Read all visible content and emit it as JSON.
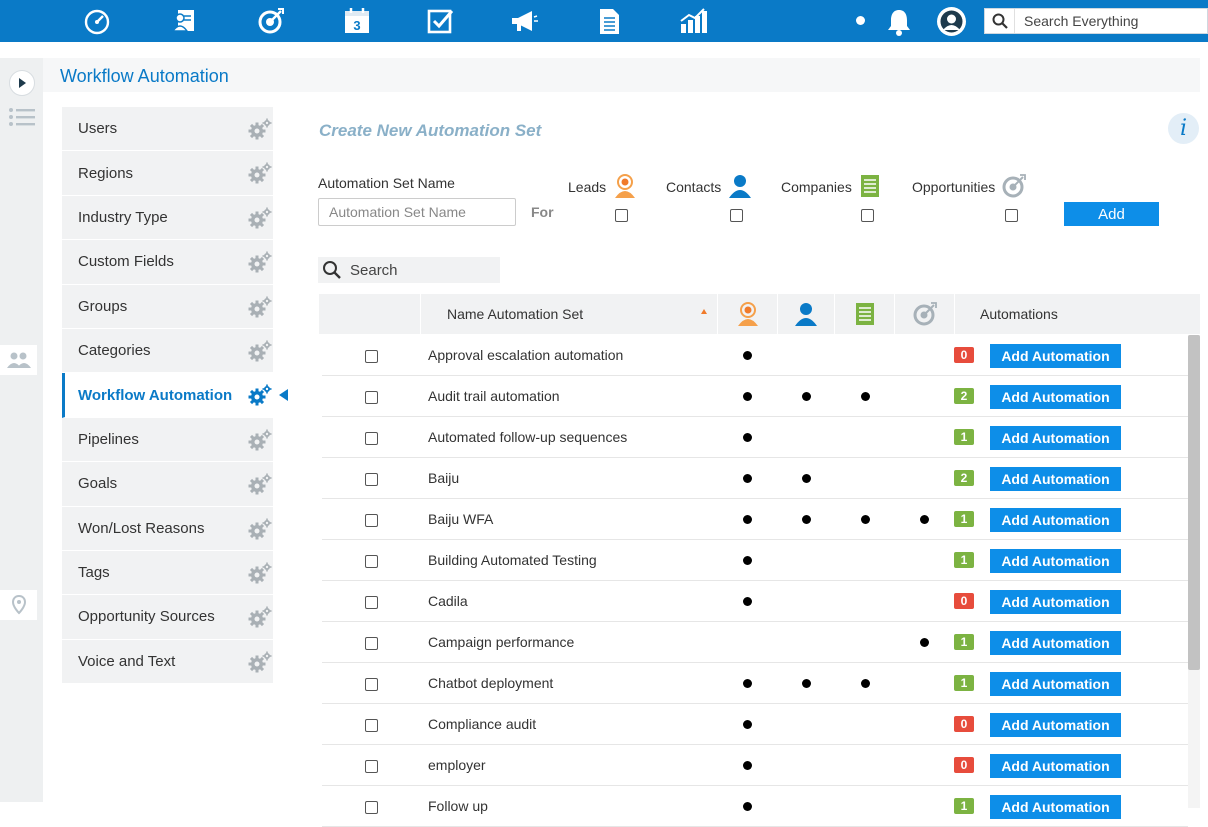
{
  "topbar": {
    "nav_icons": [
      "dashboard-icon",
      "contacts-card-icon",
      "opportunity-target-icon",
      "calendar-icon",
      "tasks-checkbox-icon",
      "campaign-megaphone-icon",
      "documents-icon",
      "reports-chart-icon"
    ],
    "calendar_day": "3",
    "search_placeholder": "Search Everything"
  },
  "page": {
    "title": "Workflow Automation"
  },
  "side_menu": {
    "items": [
      {
        "label": "Users"
      },
      {
        "label": "Regions"
      },
      {
        "label": "Industry Type"
      },
      {
        "label": "Custom Fields"
      },
      {
        "label": "Groups"
      },
      {
        "label": "Categories"
      },
      {
        "label": "Workflow Automation",
        "active": true
      },
      {
        "label": "Pipelines"
      },
      {
        "label": "Goals"
      },
      {
        "label": "Won/Lost Reasons"
      },
      {
        "label": "Tags"
      },
      {
        "label": "Opportunity Sources"
      },
      {
        "label": "Voice and Text"
      }
    ]
  },
  "create_form": {
    "title": "Create New Automation Set",
    "name_label": "Automation Set Name",
    "name_placeholder": "Automation Set Name",
    "for_label": "For",
    "types": [
      {
        "label": "Leads",
        "icon": "leads-icon"
      },
      {
        "label": "Contacts",
        "icon": "contacts-icon"
      },
      {
        "label": "Companies",
        "icon": "companies-icon"
      },
      {
        "label": "Opportunities",
        "icon": "opportunities-icon"
      }
    ],
    "add_label": "Add",
    "info_symbol": "i"
  },
  "table": {
    "search_placeholder": "Search",
    "headers": {
      "name": "Name Automation Set",
      "automations": "Automations"
    },
    "add_automation_label": "Add Automation",
    "colors": {
      "badge_zero": "#e74c3c",
      "badge_nonzero": "#7cb342",
      "accent": "#0a7ac7"
    },
    "rows": [
      {
        "name": "Approval escalation automation",
        "leads": true,
        "contacts": false,
        "companies": false,
        "opportunities": false,
        "count": "0"
      },
      {
        "name": "Audit trail automation",
        "leads": true,
        "contacts": true,
        "companies": true,
        "opportunities": false,
        "count": "2"
      },
      {
        "name": "Automated follow-up sequences",
        "leads": true,
        "contacts": false,
        "companies": false,
        "opportunities": false,
        "count": "1"
      },
      {
        "name": "Baiju",
        "leads": true,
        "contacts": true,
        "companies": false,
        "opportunities": false,
        "count": "2"
      },
      {
        "name": "Baiju WFA",
        "leads": true,
        "contacts": true,
        "companies": true,
        "opportunities": true,
        "count": "1"
      },
      {
        "name": "Building Automated Testing",
        "leads": true,
        "contacts": false,
        "companies": false,
        "opportunities": false,
        "count": "1"
      },
      {
        "name": "Cadila",
        "leads": true,
        "contacts": false,
        "companies": false,
        "opportunities": false,
        "count": "0"
      },
      {
        "name": "Campaign performance",
        "leads": false,
        "contacts": false,
        "companies": false,
        "opportunities": true,
        "count": "1"
      },
      {
        "name": "Chatbot deployment",
        "leads": true,
        "contacts": true,
        "companies": true,
        "opportunities": false,
        "count": "1"
      },
      {
        "name": "Compliance audit",
        "leads": true,
        "contacts": false,
        "companies": false,
        "opportunities": false,
        "count": "0"
      },
      {
        "name": "employer",
        "leads": true,
        "contacts": false,
        "companies": false,
        "opportunities": false,
        "count": "0"
      },
      {
        "name": "Follow up",
        "leads": true,
        "contacts": false,
        "companies": false,
        "opportunities": false,
        "count": "1"
      }
    ]
  }
}
